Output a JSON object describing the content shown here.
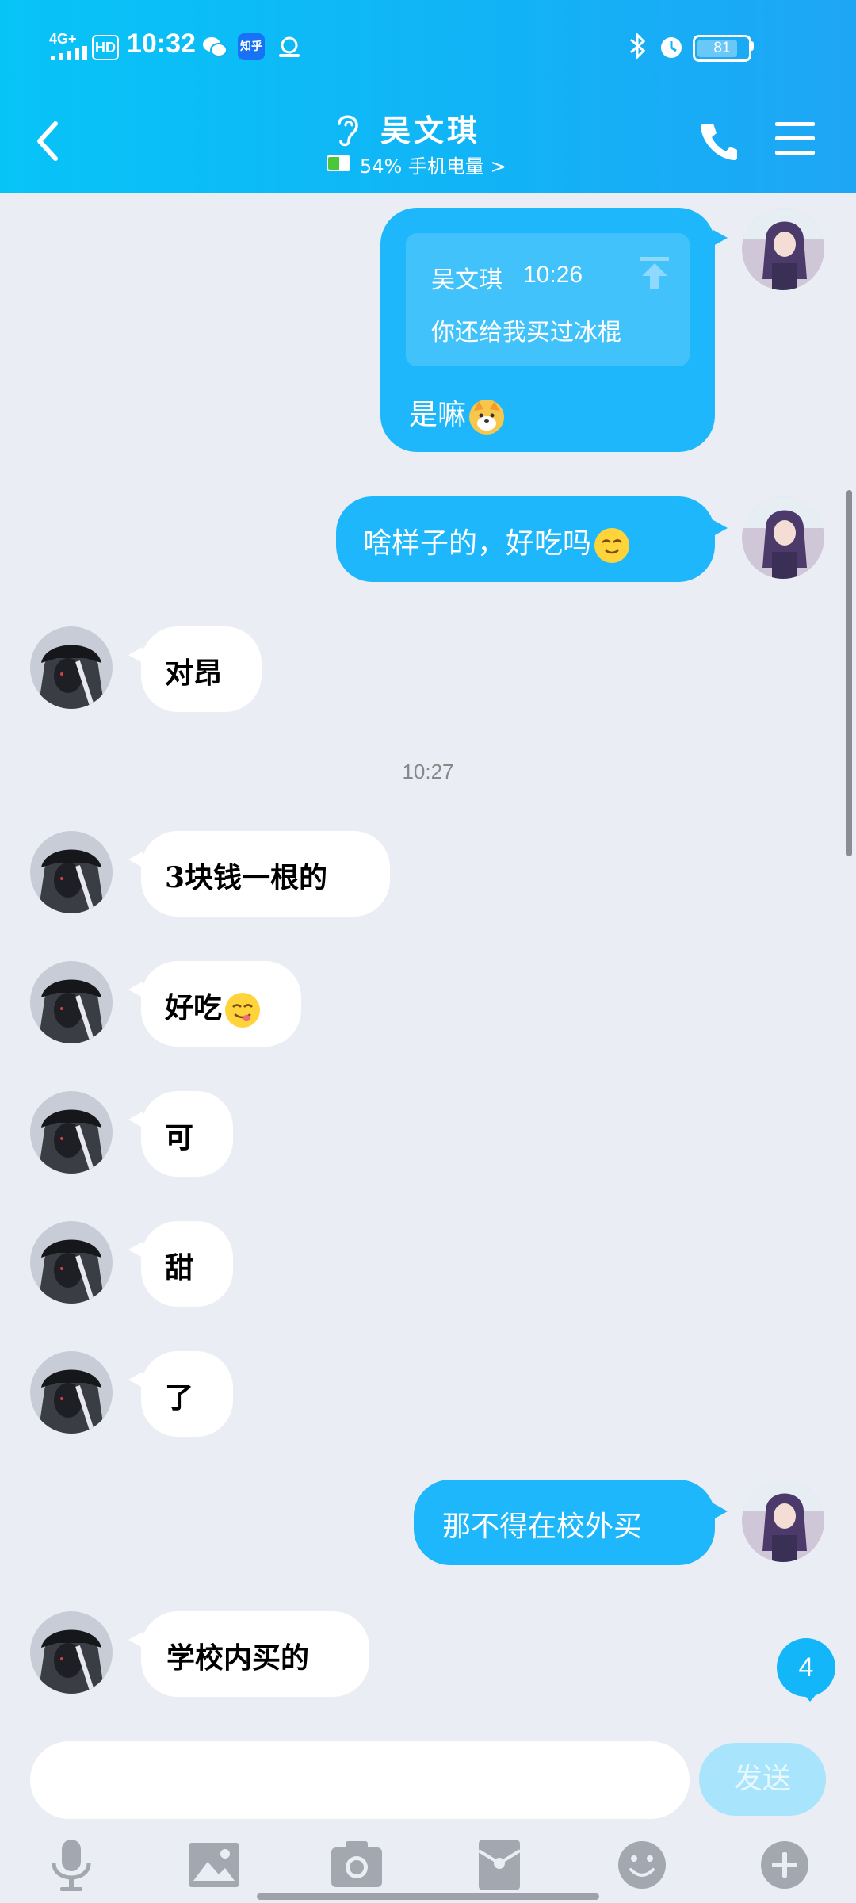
{
  "status_bar": {
    "network": "4G+",
    "hd": "HD",
    "time": "10:32",
    "zhihu_label": "知乎",
    "battery": "81",
    "battery_level": 0.81
  },
  "header": {
    "contact_name": "吴文琪",
    "device_status": "54% 手机电量 >",
    "device_battery_level": 0.54
  },
  "messages": [
    {
      "side": "out",
      "reply": {
        "sender": "吴文琪",
        "time": "10:26",
        "text": "你还给我买过冰棍"
      },
      "text": "是嘛",
      "emoji": "dog-face-emoji"
    },
    {
      "side": "out",
      "text": "啥样子的，好吃吗",
      "emoji": "smiling-face-emoji"
    },
    {
      "side": "in",
      "text": "对昂"
    },
    {
      "side": "in",
      "text": "3块钱一根的"
    },
    {
      "side": "in",
      "text": "好吃",
      "emoji": "yum-face-emoji"
    },
    {
      "side": "in",
      "text": "可"
    },
    {
      "side": "in",
      "text": "甜"
    },
    {
      "side": "in",
      "text": "了"
    },
    {
      "side": "out",
      "text": "那不得在校外买"
    },
    {
      "side": "in",
      "text": "学校内买的"
    }
  ],
  "time_divider": "10:27",
  "unread_count": "4",
  "input": {
    "value": "",
    "placeholder": "",
    "send_label": "发送"
  },
  "toolbar": [
    "microphone-icon",
    "image-icon",
    "camera-icon",
    "red-packet-icon",
    "emoji-icon",
    "plus-icon"
  ],
  "colors": {
    "header_start": "#07c4f7",
    "header_end": "#1ea6f5",
    "outgoing_bubble": "#1eb7fb",
    "incoming_bubble": "#ffffff",
    "background": "#ebedf4"
  }
}
